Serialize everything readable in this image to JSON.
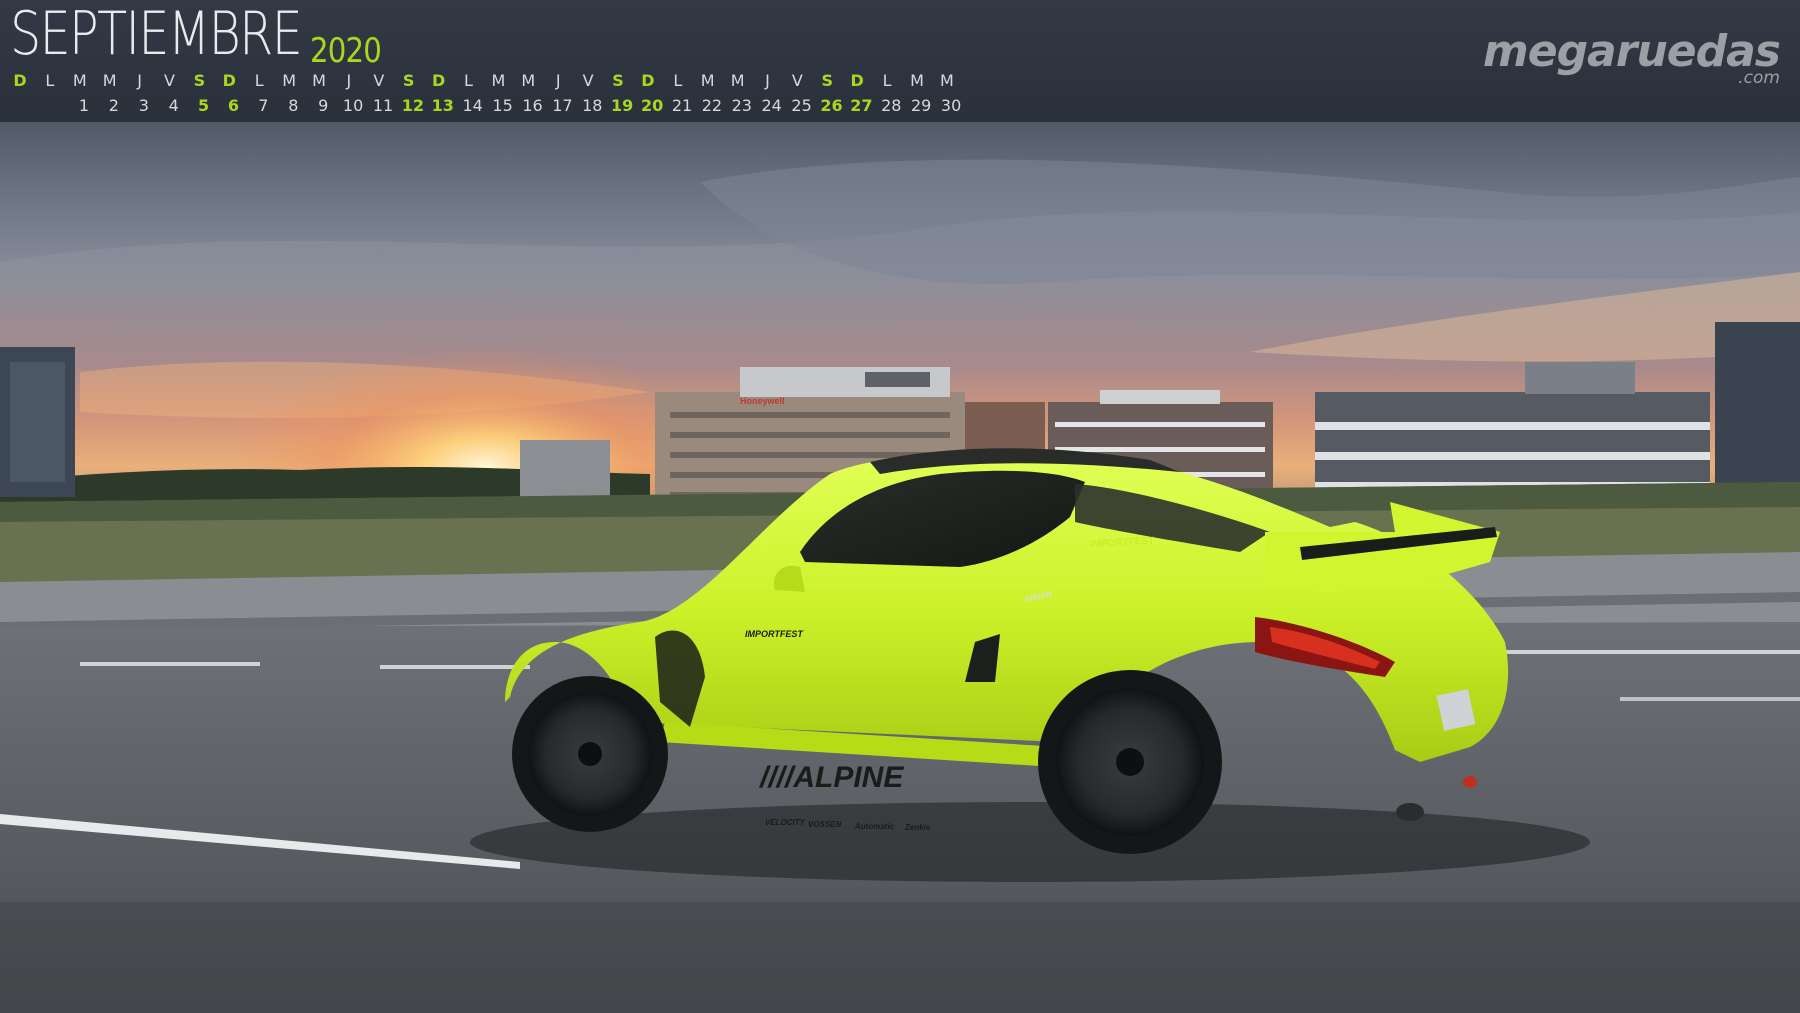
{
  "header": {
    "month": "SEPTIEMBRE",
    "year": "2020",
    "brand_name": "megaruedas",
    "brand_suffix": ".com"
  },
  "calendar": {
    "day_letters": [
      "D",
      "L",
      "M",
      "M",
      "J",
      "V",
      "S",
      "D",
      "L",
      "M",
      "M",
      "J",
      "V",
      "S",
      "D",
      "L",
      "M",
      "M",
      "J",
      "V",
      "S",
      "D",
      "L",
      "M",
      "M",
      "J",
      "V",
      "S",
      "D",
      "L",
      "M",
      "M"
    ],
    "day_letter_weekend_flags": [
      true,
      false,
      false,
      false,
      false,
      false,
      true,
      true,
      false,
      false,
      false,
      false,
      false,
      true,
      true,
      false,
      false,
      false,
      false,
      false,
      true,
      true,
      false,
      false,
      false,
      false,
      false,
      true,
      true,
      false,
      false,
      false
    ],
    "days": [
      {
        "n": "1",
        "weekend": false
      },
      {
        "n": "2",
        "weekend": false
      },
      {
        "n": "3",
        "weekend": false
      },
      {
        "n": "4",
        "weekend": false
      },
      {
        "n": "5",
        "weekend": true
      },
      {
        "n": "6",
        "weekend": true
      },
      {
        "n": "7",
        "weekend": false
      },
      {
        "n": "8",
        "weekend": false
      },
      {
        "n": "9",
        "weekend": false
      },
      {
        "n": "10",
        "weekend": false
      },
      {
        "n": "11",
        "weekend": false
      },
      {
        "n": "12",
        "weekend": true
      },
      {
        "n": "13",
        "weekend": true
      },
      {
        "n": "14",
        "weekend": false
      },
      {
        "n": "15",
        "weekend": false
      },
      {
        "n": "16",
        "weekend": false
      },
      {
        "n": "17",
        "weekend": false
      },
      {
        "n": "18",
        "weekend": false
      },
      {
        "n": "19",
        "weekend": true
      },
      {
        "n": "20",
        "weekend": true
      },
      {
        "n": "21",
        "weekend": false
      },
      {
        "n": "22",
        "weekend": false
      },
      {
        "n": "23",
        "weekend": false
      },
      {
        "n": "24",
        "weekend": false
      },
      {
        "n": "25",
        "weekend": false
      },
      {
        "n": "26",
        "weekend": true
      },
      {
        "n": "27",
        "weekend": true
      },
      {
        "n": "28",
        "weekend": false
      },
      {
        "n": "29",
        "weekend": false
      },
      {
        "n": "30",
        "weekend": false
      }
    ]
  },
  "car": {
    "sponsor_main": "////ALPINE",
    "sponsor_door": "IMPORTFEST",
    "sponsor_window": "ADVAN",
    "sponsor_roof": "IMPORTFEST",
    "sponsors_skirt": [
      "VELOCITY",
      "VOSSEN",
      "Automatic",
      "Zenkis"
    ]
  },
  "building": {
    "sign": "Honeywell"
  },
  "colors": {
    "accent_green": "#a8d71f",
    "header_bg": "#2f353f",
    "car_body": "#cdf52a",
    "header_text": "#d6dade",
    "brand_gray": "#9aa0a6"
  }
}
